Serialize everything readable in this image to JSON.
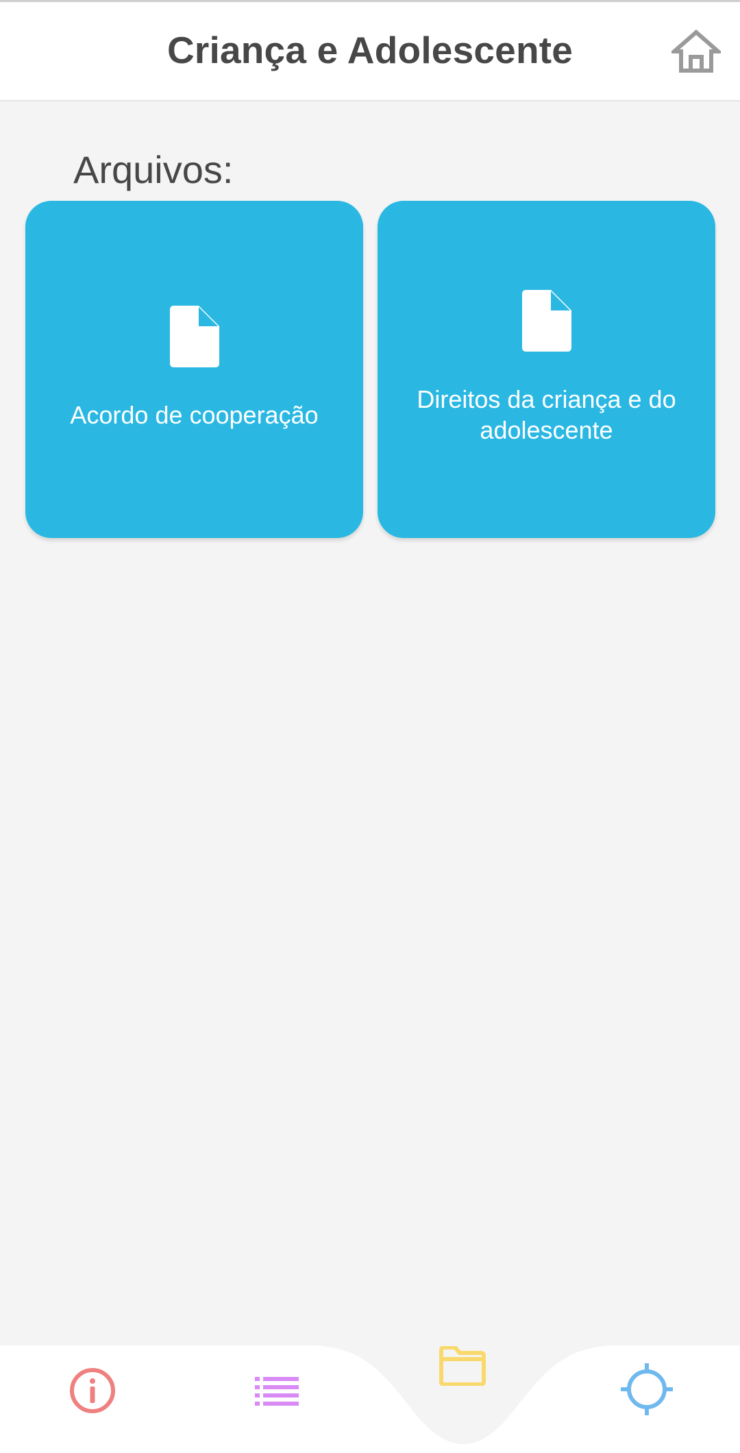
{
  "header": {
    "title": "Criança e Adolescente",
    "home_icon": "home-icon"
  },
  "section": {
    "label": "Arquivos:"
  },
  "files": [
    {
      "label": "Acordo de cooperação",
      "icon": "document-icon"
    },
    {
      "label": "Direitos da criança e do adolescente",
      "icon": "document-icon"
    }
  ],
  "bottom_nav": {
    "items": [
      {
        "icon": "info-icon",
        "color": "#ef8080"
      },
      {
        "icon": "list-icon",
        "color": "#d98af5"
      },
      {
        "icon": "folder-icon",
        "color": "#f9d96b",
        "active": true
      },
      {
        "icon": "crosshair-icon",
        "color": "#6fb9ee"
      }
    ]
  },
  "colors": {
    "card_background": "#2ab8e3",
    "page_background": "#f4f4f4",
    "header_text": "#474747"
  }
}
